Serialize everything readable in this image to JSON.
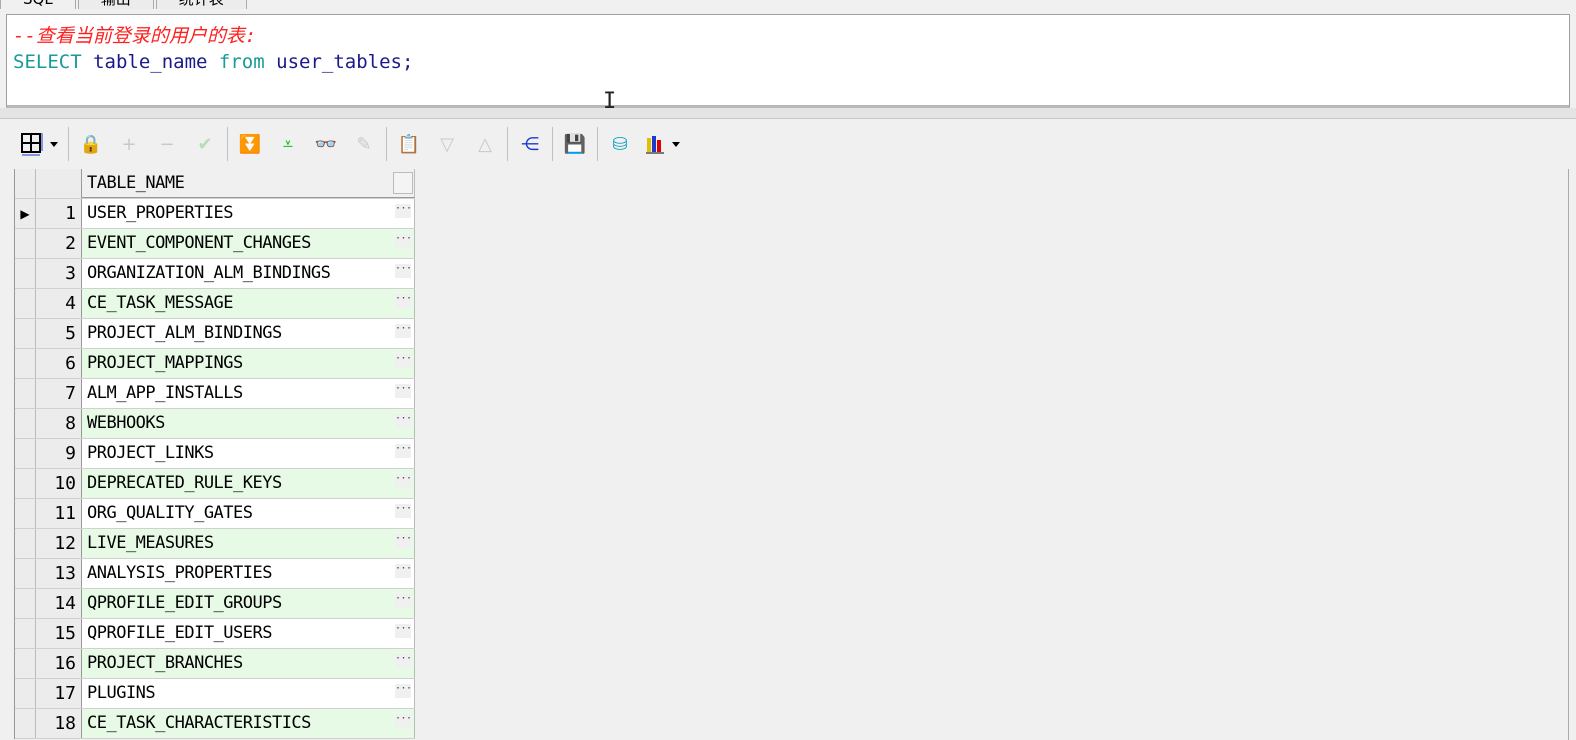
{
  "tabs": [
    "SQL",
    "输出",
    "统计表"
  ],
  "editor": {
    "comment": "--查看当前登录的用户的表:",
    "sql_kw1": "SELECT",
    "sql_p1": " table_name ",
    "sql_kw2": "from",
    "sql_p2": " user_tables;"
  },
  "toolbar": {
    "icons": [
      "grid-layout-icon",
      "lock-icon",
      "add-record-icon",
      "delete-record-icon",
      "post-changes-icon",
      "fetch-next-icon",
      "fetch-last-icon",
      "find-icon",
      "clear-icon",
      "single-record-view-icon",
      "previous-record-icon",
      "next-record-icon",
      "query-plan-icon",
      "save-icon",
      "export-icon",
      "chart-icon"
    ]
  },
  "grid": {
    "header": "TABLE_NAME",
    "rows": [
      "USER_PROPERTIES",
      "EVENT_COMPONENT_CHANGES",
      "ORGANIZATION_ALM_BINDINGS",
      "CE_TASK_MESSAGE",
      "PROJECT_ALM_BINDINGS",
      "PROJECT_MAPPINGS",
      "ALM_APP_INSTALLS",
      "WEBHOOKS",
      "PROJECT_LINKS",
      "DEPRECATED_RULE_KEYS",
      "ORG_QUALITY_GATES",
      "LIVE_MEASURES",
      "ANALYSIS_PROPERTIES",
      "QPROFILE_EDIT_GROUPS",
      "QPROFILE_EDIT_USERS",
      "PROJECT_BRANCHES",
      "PLUGINS",
      "CE_TASK_CHARACTERISTICS"
    ]
  },
  "colors": {
    "comment": "#ff2020",
    "keyword": "#1a9a9a",
    "identifier": "#1a1a8a",
    "alt_row": "#e6fae6"
  }
}
